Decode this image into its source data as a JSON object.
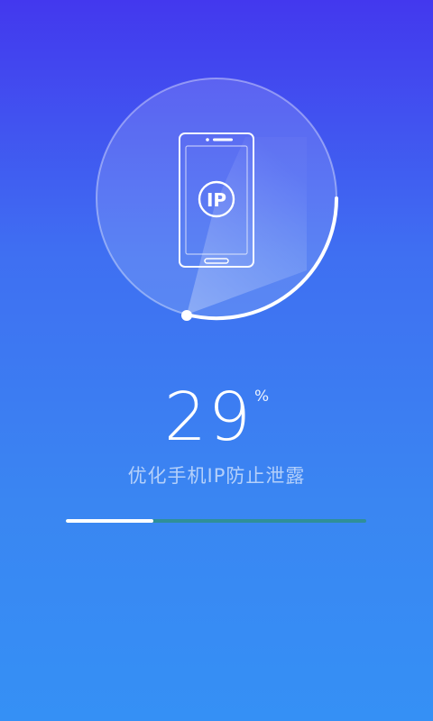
{
  "scan": {
    "badge_text": "IP",
    "progress": 0.29,
    "percent_value": "29",
    "percent_sign": "%",
    "subtitle": "优化手机IP防止泄露"
  },
  "icons": {
    "phone": "smartphone-icon",
    "badge": "ip-badge-icon"
  },
  "colors": {
    "background_top": "#4338ee",
    "background_bottom": "#3590f5",
    "progress_track": "#2f8f99",
    "progress_fill": "#ffffff"
  }
}
